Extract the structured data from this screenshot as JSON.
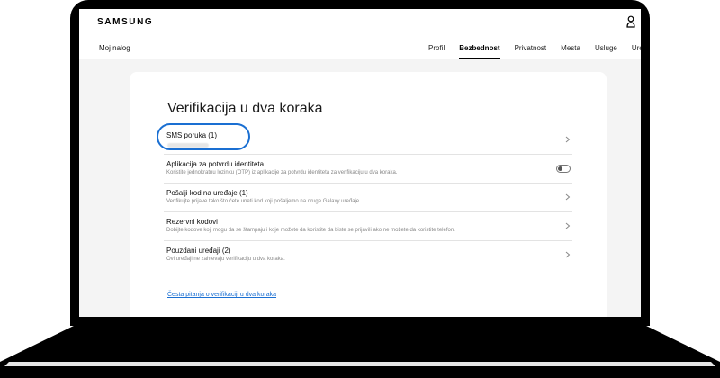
{
  "header": {
    "logo": "SAMSUNG",
    "account_title": "Moj nalog",
    "tabs": [
      {
        "label": "Profil",
        "active": false
      },
      {
        "label": "Bezbednost",
        "active": true
      },
      {
        "label": "Privatnost",
        "active": false
      },
      {
        "label": "Mesta",
        "active": false
      },
      {
        "label": "Usluge",
        "active": false
      },
      {
        "label": "Uređaj",
        "active": false
      }
    ]
  },
  "page": {
    "title": "Verifikacija u dva koraka",
    "faq_link": "Česta pitanja o verifikaciji u dva koraka"
  },
  "options": [
    {
      "title": "SMS poruka (1)",
      "description": "",
      "control": "chevron",
      "icon": "chevron-right-icon"
    },
    {
      "title": "Aplikacija za potvrdu identiteta",
      "description": "Koristite jednokratnu lozinku (OTP) iz aplikacije za potvrdu identiteta za verifikaciju u dva koraka.",
      "control": "toggle",
      "toggle_on": false
    },
    {
      "title": "Pošalji kod na uređaje (1)",
      "description": "Verifikujte prijave tako što ćete uneti kod koji pošaljemo na druge Galaxy uređaje.",
      "control": "chevron",
      "icon": "chevron-right-icon"
    },
    {
      "title": "Rezervni kodovi",
      "description": "Dobijte kodove koji mogu da se štampaju i koje možete da koristite da biste se prijavili ako ne možete da koristite telefon.",
      "control": "chevron",
      "icon": "chevron-right-icon"
    },
    {
      "title": "Pouzdani uređaji (2)",
      "description": "Ovi uređaji ne zahtevaju verifikaciju u dva koraka.",
      "control": "chevron",
      "icon": "chevron-right-icon"
    }
  ],
  "colors": {
    "accent": "#1a6fd2",
    "frame": "#000000",
    "content_background": "#f4f4f4"
  }
}
